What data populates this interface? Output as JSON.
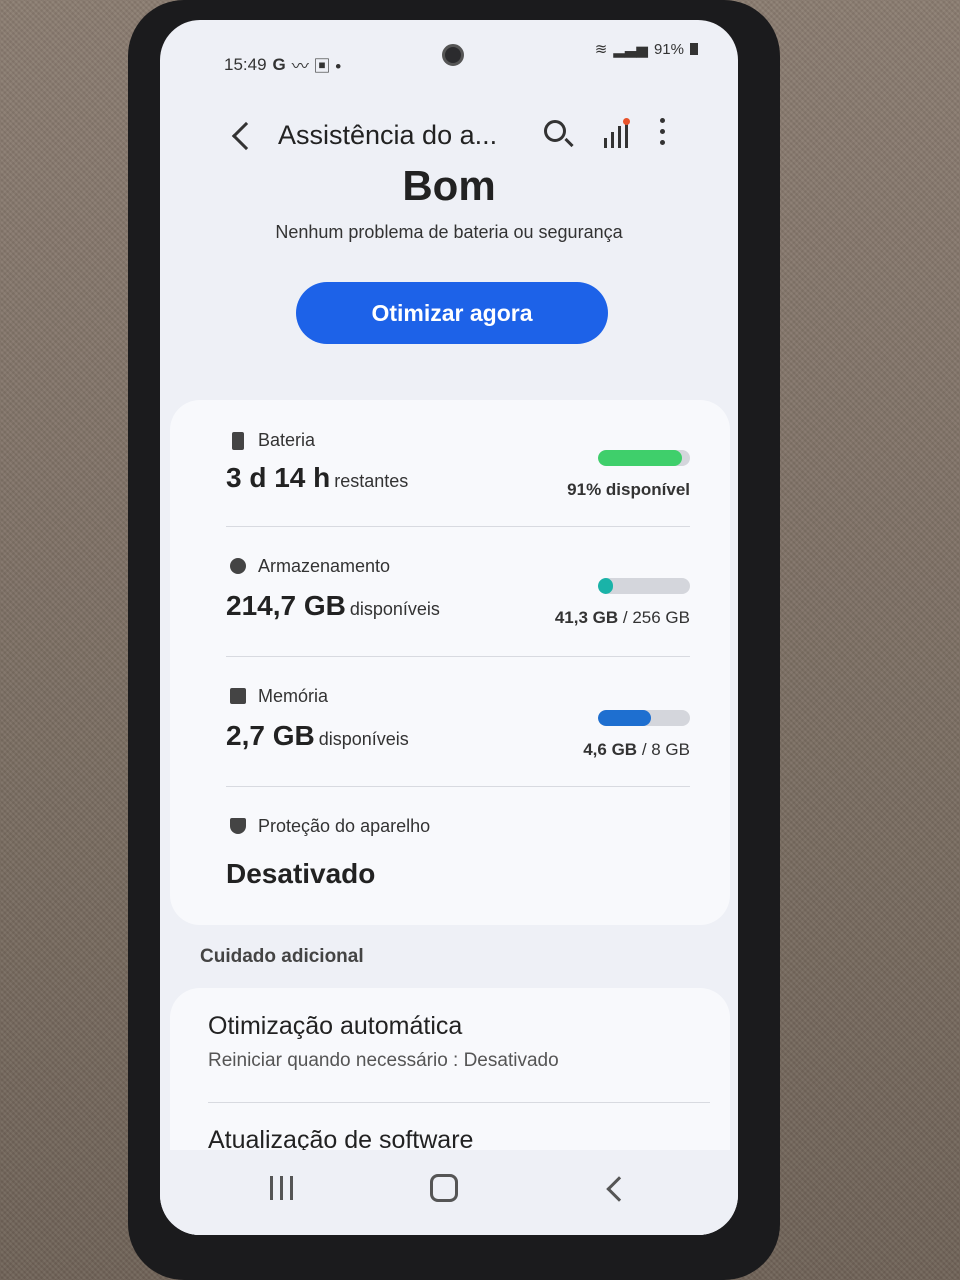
{
  "statusbar": {
    "time": "15:49",
    "indicators": "G",
    "battery_pct": "91%"
  },
  "appbar": {
    "title": "Assistência do a..."
  },
  "summary": {
    "status": "Bom",
    "subtitle": "Nenhum problema de bateria ou segurança",
    "button_label": "Otimizar agora"
  },
  "battery": {
    "label": "Bateria",
    "value": "3 d 14 h",
    "unit": "restantes",
    "meta": "91% disponível",
    "level": 0.91,
    "color": "#3fcf6b"
  },
  "storage": {
    "label": "Armazenamento",
    "value": "214,7 GB",
    "unit": "disponíveis",
    "used": "41,3 GB",
    "total": "/ 256 GB",
    "level": 0.16,
    "color": "#1ab3a8"
  },
  "memory": {
    "label": "Memória",
    "value": "2,7 GB",
    "unit": "disponíveis",
    "used": "4,6 GB",
    "total": "/ 8 GB",
    "level": 0.575,
    "color": "#1e6fd0"
  },
  "protection": {
    "label": "Proteção do aparelho",
    "value": "Desativado"
  },
  "additional": {
    "header": "Cuidado adicional",
    "auto_opt_title": "Otimização automática",
    "auto_opt_sub": "Reiniciar quando necessário : Desativado",
    "update_title": "Atualização de software"
  }
}
